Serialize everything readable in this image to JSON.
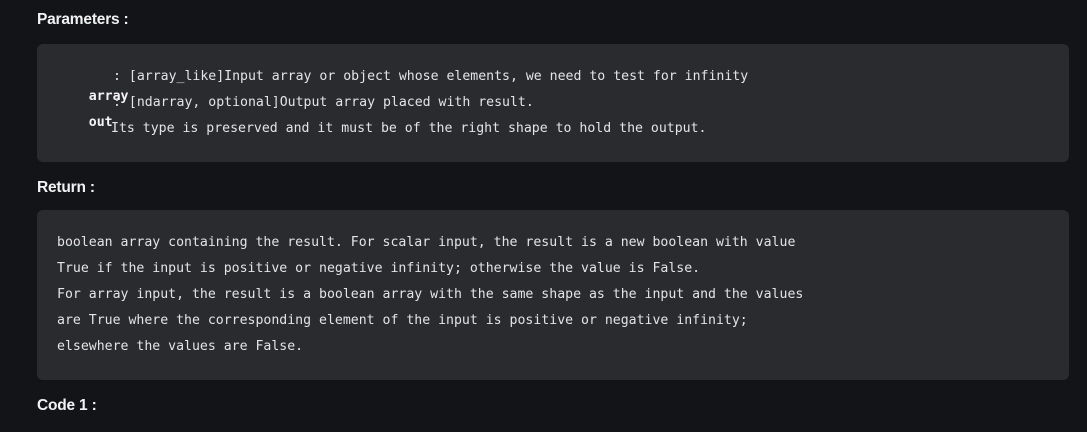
{
  "sections": {
    "parameters": {
      "heading": "Parameters :",
      "params": [
        {
          "name": "array",
          "desc": ": [array_like]Input array or object whose elements, we need to test for infinity"
        },
        {
          "name": "out",
          "desc": ": [ndarray, optional]Output array placed with result."
        }
      ],
      "continuation": "Its type is preserved and it must be of the right shape to hold the output."
    },
    "return": {
      "heading": "Return :",
      "lines": [
        "boolean array containing the result. For scalar input, the result is a new boolean with value",
        "True if the input is positive or negative infinity; otherwise the value is False.",
        "For array input, the result is a boolean array with the same shape as the input and the values",
        "are True where the corresponding element of the input is positive or negative infinity;",
        "elsewhere the values are False."
      ]
    },
    "code1": {
      "heading": "Code 1 :"
    }
  },
  "colors": {
    "page_background": "#131417",
    "block_background": "#2a2b2f",
    "text": "#e4e4e6"
  }
}
